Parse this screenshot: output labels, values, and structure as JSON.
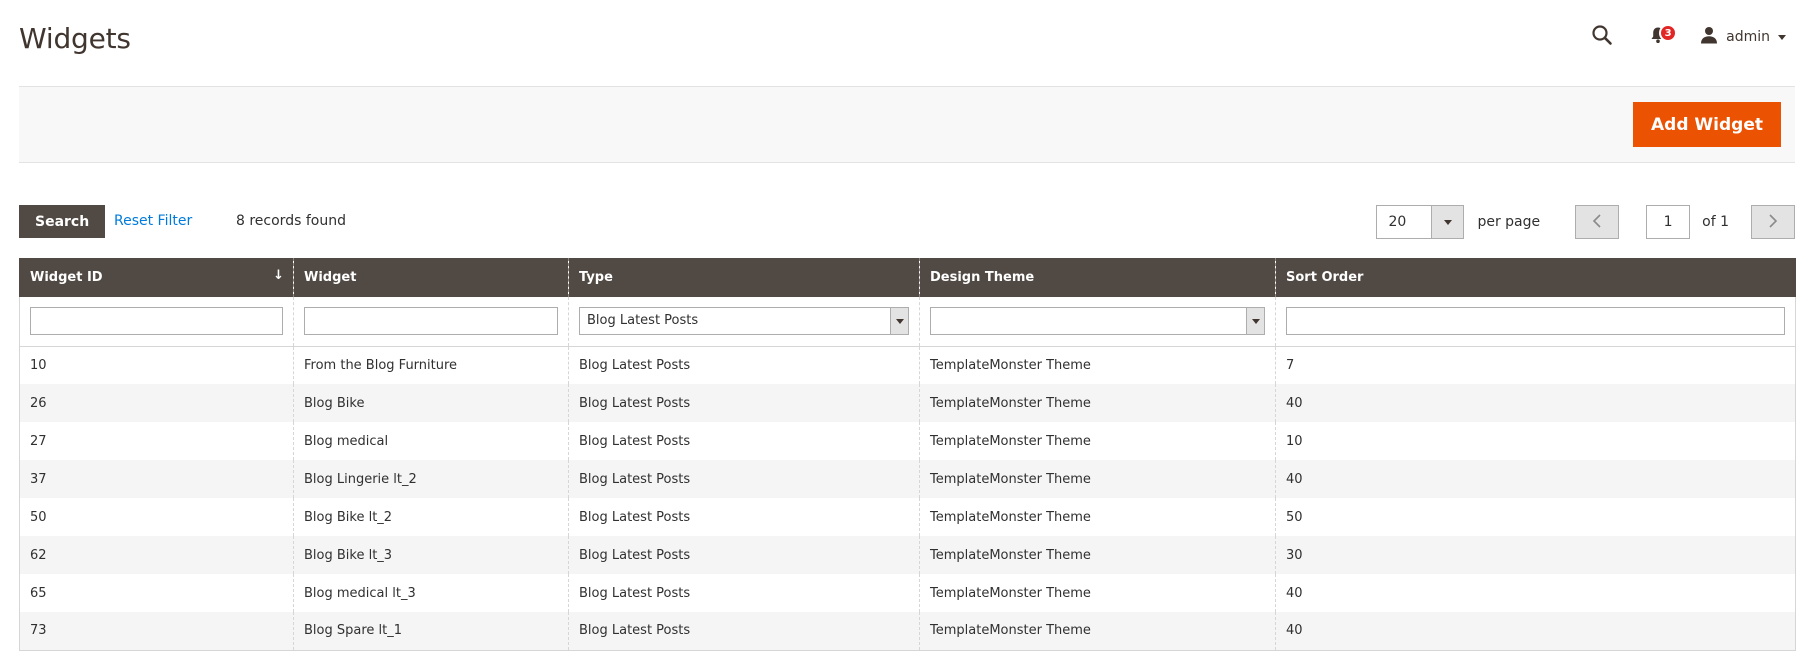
{
  "header": {
    "title": "Widgets",
    "notification_count": "3",
    "user_name": "admin"
  },
  "actions": {
    "add_label": "Add Widget"
  },
  "toolbar": {
    "search_label": "Search",
    "reset_label": "Reset Filter",
    "records_text": "8 records found",
    "per_page_value": "20",
    "per_page_label": "per page",
    "page_value": "1",
    "of_label": "of 1"
  },
  "grid": {
    "columns": [
      "Widget ID",
      "Widget",
      "Type",
      "Design Theme",
      "Sort Order"
    ],
    "filters": {
      "id": "",
      "widget": "",
      "type": "Blog Latest Posts",
      "theme": "",
      "sort_order": ""
    },
    "rows": [
      [
        "10",
        "From the Blog Furniture",
        "Blog Latest Posts",
        "TemplateMonster Theme",
        "7"
      ],
      [
        "26",
        "Blog Bike",
        "Blog Latest Posts",
        "TemplateMonster Theme",
        "40"
      ],
      [
        "27",
        "Blog medical",
        "Blog Latest Posts",
        "TemplateMonster Theme",
        "10"
      ],
      [
        "37",
        "Blog Lingerie lt_2",
        "Blog Latest Posts",
        "TemplateMonster Theme",
        "40"
      ],
      [
        "50",
        "Blog Bike lt_2",
        "Blog Latest Posts",
        "TemplateMonster Theme",
        "50"
      ],
      [
        "62",
        "Blog Bike lt_3",
        "Blog Latest Posts",
        "TemplateMonster Theme",
        "30"
      ],
      [
        "65",
        "Blog medical lt_3",
        "Blog Latest Posts",
        "TemplateMonster Theme",
        "40"
      ],
      [
        "73",
        "Blog Spare lt_1",
        "Blog Latest Posts",
        "TemplateMonster Theme",
        "40"
      ]
    ]
  },
  "colors": {
    "accent": "#eb5202",
    "header_bg": "#514943",
    "link": "#007bdb",
    "badge": "#e22626"
  },
  "icons": [
    "search-icon",
    "bell-icon",
    "user-icon",
    "chevron-left-icon",
    "chevron-right-icon",
    "sort-arrow-icon"
  ]
}
